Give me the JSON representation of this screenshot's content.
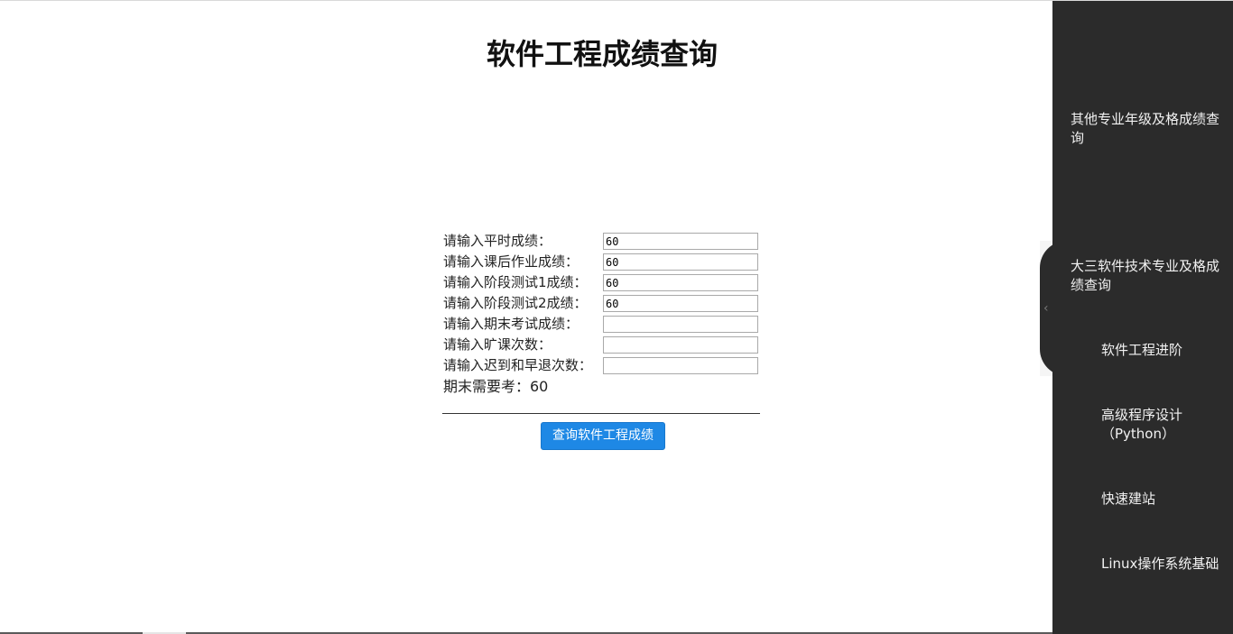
{
  "header": {
    "title": "软件工程成绩查询"
  },
  "form": {
    "rows": [
      {
        "label": "请输入平时成绩：",
        "value": "60"
      },
      {
        "label": "请输入课后作业成绩：",
        "value": "60"
      },
      {
        "label": "请输入阶段测试1成绩：",
        "value": "60"
      },
      {
        "label": "请输入阶段测试2成绩：",
        "value": "60"
      },
      {
        "label": "请输入期末考试成绩：",
        "value": ""
      },
      {
        "label": "请输入旷课次数：",
        "value": ""
      },
      {
        "label": "请输入迟到和早退次数：",
        "value": ""
      }
    ],
    "result": "期末需要考：60",
    "query_button": "查询软件工程成绩"
  },
  "sidebar": {
    "toggle_icon": "chevron-left-icon",
    "items": [
      {
        "label": "其他专业年级及格成绩查询"
      },
      {
        "label": "大三软件技术专业及格成绩查询"
      },
      {
        "label": "软件工程进阶"
      },
      {
        "label": "高级程序设计（Python）"
      },
      {
        "label": "快速建站"
      },
      {
        "label": "Linux操作系统基础"
      }
    ]
  },
  "colors": {
    "button_bg": "#1e88e5",
    "sidebar_bg": "#2b2b2b"
  }
}
